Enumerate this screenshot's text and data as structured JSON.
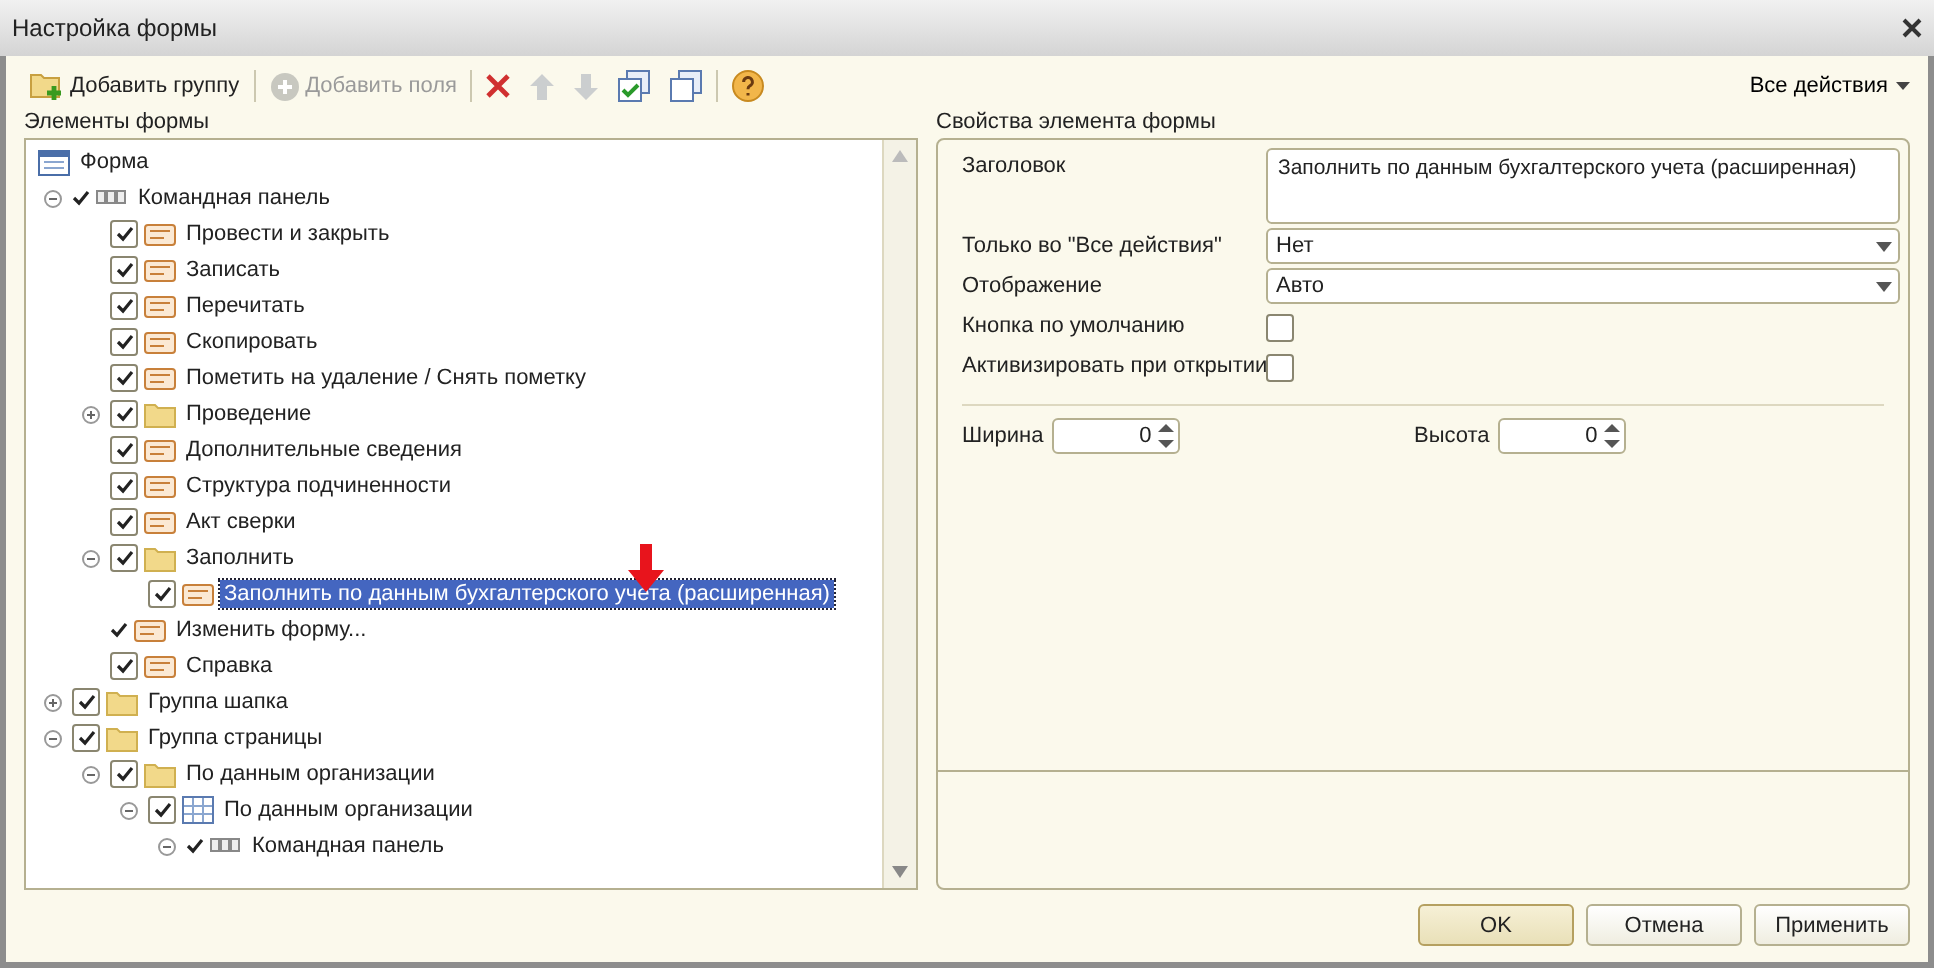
{
  "window": {
    "title": "Настройка формы"
  },
  "toolbar": [
    {
      "kind": "add_group",
      "label": "Добавить группу",
      "disabled": false
    },
    {
      "kind": "add_fields",
      "label": "Добавить поля",
      "disabled": true
    },
    {
      "kind": "delete",
      "disabled": false
    },
    {
      "kind": "move_up",
      "disabled": true
    },
    {
      "kind": "move_down",
      "disabled": true
    },
    {
      "kind": "check_all",
      "disabled": false
    },
    {
      "kind": "uncheck_all",
      "disabled": false
    },
    {
      "kind": "help",
      "disabled": false
    }
  ],
  "all_actions": "Все действия",
  "tree": {
    "title": "Элементы формы",
    "items": [
      {
        "kind": "form",
        "label": "Форма",
        "selected": false,
        "children": [
          {
            "kind": "command_bar",
            "label": "Командная панель",
            "checked": true,
            "boxed": false,
            "expanded": true,
            "selected": false,
            "children": [
              {
                "kind": "command",
                "label": "Провести и закрыть",
                "checked": true,
                "selected": false
              },
              {
                "kind": "command",
                "label": "Записать",
                "checked": true,
                "selected": false
              },
              {
                "kind": "command",
                "label": "Перечитать",
                "checked": true,
                "selected": false
              },
              {
                "kind": "command",
                "label": "Скопировать",
                "checked": true,
                "selected": false
              },
              {
                "kind": "command",
                "label": "Пометить на удаление / Снять пометку",
                "checked": true,
                "selected": false
              },
              {
                "kind": "folder",
                "label": "Проведение",
                "checked": true,
                "expanded": false,
                "selected": false
              },
              {
                "kind": "command",
                "label": "Дополнительные сведения",
                "checked": true,
                "selected": false
              },
              {
                "kind": "command",
                "label": "Структура подчиненности",
                "checked": true,
                "selected": false
              },
              {
                "kind": "command",
                "label": "Акт сверки",
                "checked": true,
                "selected": false
              },
              {
                "kind": "folder",
                "label": "Заполнить",
                "checked": true,
                "expanded": true,
                "selected": false,
                "children": [
                  {
                    "kind": "command",
                    "label": "Заполнить по данным бухгалтерского учета (расширенная)",
                    "checked": true,
                    "selected": true
                  }
                ]
              },
              {
                "kind": "command",
                "label": "Изменить форму...",
                "checked": true,
                "boxed": false,
                "selected": false
              },
              {
                "kind": "command",
                "label": "Справка",
                "checked": true,
                "selected": false
              }
            ]
          },
          {
            "kind": "folder",
            "label": "Группа шапка",
            "checked": true,
            "expanded": false,
            "selected": false
          },
          {
            "kind": "folder",
            "label": "Группа страницы",
            "checked": true,
            "expanded": true,
            "selected": false,
            "children": [
              {
                "kind": "folder",
                "label": "По данным организации",
                "checked": true,
                "expanded": true,
                "selected": false,
                "children": [
                  {
                    "kind": "table",
                    "label": "По данным организации",
                    "checked": true,
                    "expanded": true,
                    "selected": false,
                    "children": [
                      {
                        "kind": "command_bar",
                        "label": "Командная панель",
                        "checked": true,
                        "boxed": false,
                        "expanded": true,
                        "selected": false
                      }
                    ]
                  }
                ]
              }
            ]
          }
        ]
      }
    ]
  },
  "properties": {
    "title": "Свойства элемента формы",
    "rows": [
      {
        "kind": "textarea",
        "label": "Заголовок",
        "value": "Заполнить по данным бухгалтерского учета (расширенная)"
      },
      {
        "kind": "select",
        "label": "Только во \"Все действия\"",
        "value": "Нет"
      },
      {
        "kind": "select",
        "label": "Отображение",
        "value": "Авто"
      },
      {
        "kind": "checkbox",
        "label": "Кнопка по умолчанию",
        "checked": false
      },
      {
        "kind": "checkbox",
        "label": "Активизировать при открытии",
        "checked": false
      }
    ],
    "sizes": [
      {
        "label": "Ширина",
        "value": "0"
      },
      {
        "label": "Высота",
        "value": "0"
      }
    ]
  },
  "buttons": [
    {
      "label": "OK",
      "default": true
    },
    {
      "label": "Отмена",
      "default": false
    },
    {
      "label": "Применить",
      "default": false
    }
  ]
}
